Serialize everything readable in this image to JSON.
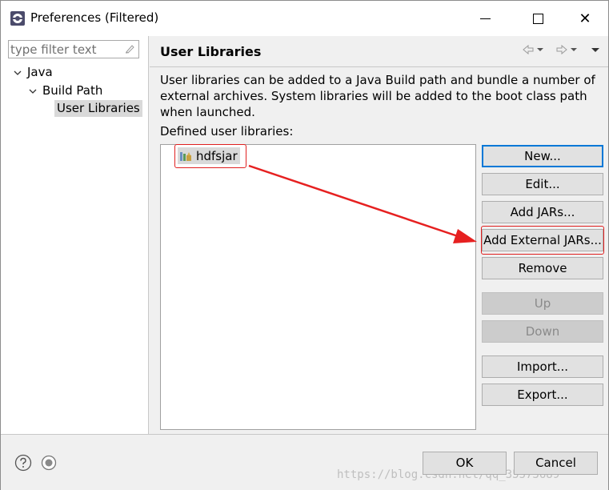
{
  "window": {
    "title": "Preferences (Filtered)",
    "controls": {
      "minimize": "minimize",
      "maximize": "maximize",
      "close": "✕"
    }
  },
  "left": {
    "filter_placeholder": "type filter text",
    "tree": [
      {
        "label": "Java",
        "expanded": true
      },
      {
        "label": "Build Path",
        "expanded": true
      },
      {
        "label": "User Libraries",
        "selected": true
      }
    ]
  },
  "page": {
    "title": "User Libraries",
    "description": "User libraries can be added to a Java Build path and bundle a number of external archives. System libraries will be added to the boot class path when launched.",
    "defined_label": "Defined user libraries:",
    "libraries": [
      {
        "name": "hdfsjar"
      }
    ],
    "buttons": [
      {
        "label": "New...",
        "enabled": true
      },
      {
        "label": "Edit...",
        "enabled": true
      },
      {
        "label": "Add JARs...",
        "enabled": true
      },
      {
        "label": "Add External JARs...",
        "enabled": true
      },
      {
        "label": "Remove",
        "enabled": true
      },
      {
        "label": "Up",
        "enabled": false
      },
      {
        "label": "Down",
        "enabled": false
      },
      {
        "label": "Import...",
        "enabled": true
      },
      {
        "label": "Export...",
        "enabled": true
      }
    ]
  },
  "footer": {
    "ok": "OK",
    "cancel": "Cancel",
    "watermark": "https://blog.csdn.net/qq_35573689"
  },
  "colors": {
    "annotation": "#e02020",
    "focus": "#0078d7",
    "selection": "#d9d9d9"
  }
}
